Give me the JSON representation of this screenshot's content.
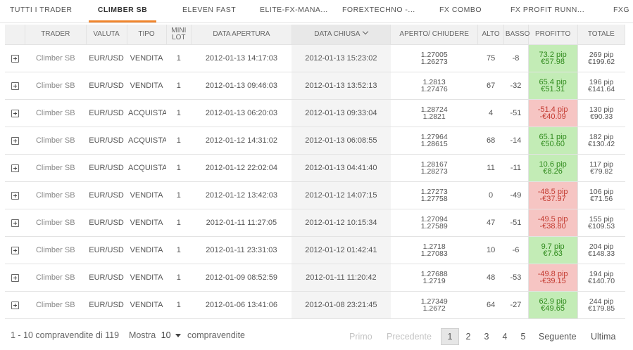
{
  "tabs": [
    {
      "label": "TUTTI I TRADER",
      "active": false
    },
    {
      "label": "CLIMBER SB",
      "active": true
    },
    {
      "label": "ELEVEN FAST",
      "active": false
    },
    {
      "label": "ELITE-FX-MANA...",
      "active": false
    },
    {
      "label": "FOREXTECHNO -...",
      "active": false
    },
    {
      "label": "FX COMBO",
      "active": false
    },
    {
      "label": "FX PROFIT RUNN...",
      "active": false
    },
    {
      "label": "FXG",
      "active": false
    }
  ],
  "table": {
    "headers": {
      "trader": "TRADER",
      "valuta": "VALUTA",
      "tipo": "TIPO",
      "mini_lot_1": "MINI",
      "mini_lot_2": "LOT",
      "data_apertura": "DATA APERTURA",
      "data_chiusa": "DATA CHIUSA",
      "aperto_chiudere": "APERTO/ CHIUDERE",
      "alto": "ALTO",
      "basso": "BASSO",
      "profitto": "PROFITTO",
      "totale": "TOTALE"
    },
    "rows": [
      {
        "trader": "Climber SB",
        "valuta": "EUR/USD",
        "tipo": "VENDITA",
        "lot": "1",
        "open_date": "2012-01-13 14:17:03",
        "close_date": "2012-01-13 15:23:02",
        "open_price": "1.27005",
        "close_price": "1.26273",
        "alto": "75",
        "basso": "-8",
        "profit_pip": "73.2 pip",
        "profit_eur": "€57.98",
        "profit_positive": true,
        "total_pip": "269 pip",
        "total_eur": "€199.62"
      },
      {
        "trader": "Climber SB",
        "valuta": "EUR/USD",
        "tipo": "VENDITA",
        "lot": "1",
        "open_date": "2012-01-13 09:46:03",
        "close_date": "2012-01-13 13:52:13",
        "open_price": "1.2813",
        "close_price": "1.27476",
        "alto": "67",
        "basso": "-32",
        "profit_pip": "65.4 pip",
        "profit_eur": "€51.31",
        "profit_positive": true,
        "total_pip": "196 pip",
        "total_eur": "€141.64"
      },
      {
        "trader": "Climber SB",
        "valuta": "EUR/USD",
        "tipo": "ACQUISTA",
        "lot": "1",
        "open_date": "2012-01-13 06:20:03",
        "close_date": "2012-01-13 09:33:04",
        "open_price": "1.28724",
        "close_price": "1.2821",
        "alto": "4",
        "basso": "-51",
        "profit_pip": "-51.4 pip",
        "profit_eur": "-€40.09",
        "profit_positive": false,
        "total_pip": "130 pip",
        "total_eur": "€90.33"
      },
      {
        "trader": "Climber SB",
        "valuta": "EUR/USD",
        "tipo": "ACQUISTA",
        "lot": "1",
        "open_date": "2012-01-12 14:31:02",
        "close_date": "2012-01-13 06:08:55",
        "open_price": "1.27964",
        "close_price": "1.28615",
        "alto": "68",
        "basso": "-14",
        "profit_pip": "65.1 pip",
        "profit_eur": "€50.60",
        "profit_positive": true,
        "total_pip": "182 pip",
        "total_eur": "€130.42"
      },
      {
        "trader": "Climber SB",
        "valuta": "EUR/USD",
        "tipo": "ACQUISTA",
        "lot": "1",
        "open_date": "2012-01-12 22:02:04",
        "close_date": "2012-01-13 04:41:40",
        "open_price": "1.28167",
        "close_price": "1.28273",
        "alto": "11",
        "basso": "-11",
        "profit_pip": "10.6 pip",
        "profit_eur": "€8.26",
        "profit_positive": true,
        "total_pip": "117 pip",
        "total_eur": "€79.82"
      },
      {
        "trader": "Climber SB",
        "valuta": "EUR/USD",
        "tipo": "VENDITA",
        "lot": "1",
        "open_date": "2012-01-12 13:42:03",
        "close_date": "2012-01-12 14:07:15",
        "open_price": "1.27273",
        "close_price": "1.27758",
        "alto": "0",
        "basso": "-49",
        "profit_pip": "-48.5 pip",
        "profit_eur": "-€37.97",
        "profit_positive": false,
        "total_pip": "106 pip",
        "total_eur": "€71.56"
      },
      {
        "trader": "Climber SB",
        "valuta": "EUR/USD",
        "tipo": "VENDITA",
        "lot": "1",
        "open_date": "2012-01-11 11:27:05",
        "close_date": "2012-01-12 10:15:34",
        "open_price": "1.27094",
        "close_price": "1.27589",
        "alto": "47",
        "basso": "-51",
        "profit_pip": "-49.5 pip",
        "profit_eur": "-€38.80",
        "profit_positive": false,
        "total_pip": "155 pip",
        "total_eur": "€109.53"
      },
      {
        "trader": "Climber SB",
        "valuta": "EUR/USD",
        "tipo": "VENDITA",
        "lot": "1",
        "open_date": "2012-01-11 23:31:03",
        "close_date": "2012-01-12 01:42:41",
        "open_price": "1.2718",
        "close_price": "1.27083",
        "alto": "10",
        "basso": "-6",
        "profit_pip": "9.7 pip",
        "profit_eur": "€7.63",
        "profit_positive": true,
        "total_pip": "204 pip",
        "total_eur": "€148.33"
      },
      {
        "trader": "Climber SB",
        "valuta": "EUR/USD",
        "tipo": "VENDITA",
        "lot": "1",
        "open_date": "2012-01-09 08:52:59",
        "close_date": "2012-01-11 11:20:42",
        "open_price": "1.27688",
        "close_price": "1.2719",
        "alto": "48",
        "basso": "-53",
        "profit_pip": "-49.8 pip",
        "profit_eur": "-€39.15",
        "profit_positive": false,
        "total_pip": "194 pip",
        "total_eur": "€140.70"
      },
      {
        "trader": "Climber SB",
        "valuta": "EUR/USD",
        "tipo": "VENDITA",
        "lot": "1",
        "open_date": "2012-01-06 13:41:06",
        "close_date": "2012-01-08 23:21:45",
        "open_price": "1.27349",
        "close_price": "1.2672",
        "alto": "64",
        "basso": "-27",
        "profit_pip": "62.9 pip",
        "profit_eur": "€49.65",
        "profit_positive": true,
        "total_pip": "244 pip",
        "total_eur": "€179.85"
      }
    ]
  },
  "footer": {
    "range_text": "1 - 10 compravendite di 119",
    "show_label": "Mostra",
    "page_size": "10",
    "page_size_suffix": "compravendite",
    "pager": {
      "first": "Primo",
      "previous": "Precedente",
      "pages": [
        "1",
        "2",
        "3",
        "4",
        "5"
      ],
      "current_page": "1",
      "next": "Seguente",
      "last": "Ultima"
    }
  },
  "colors": {
    "accent": "#f0852d",
    "profit_positive_bg": "#c3ecb6",
    "profit_positive_text": "#2f8a1c",
    "profit_negative_bg": "#f6c5c3",
    "profit_negative_text": "#c33a30"
  }
}
